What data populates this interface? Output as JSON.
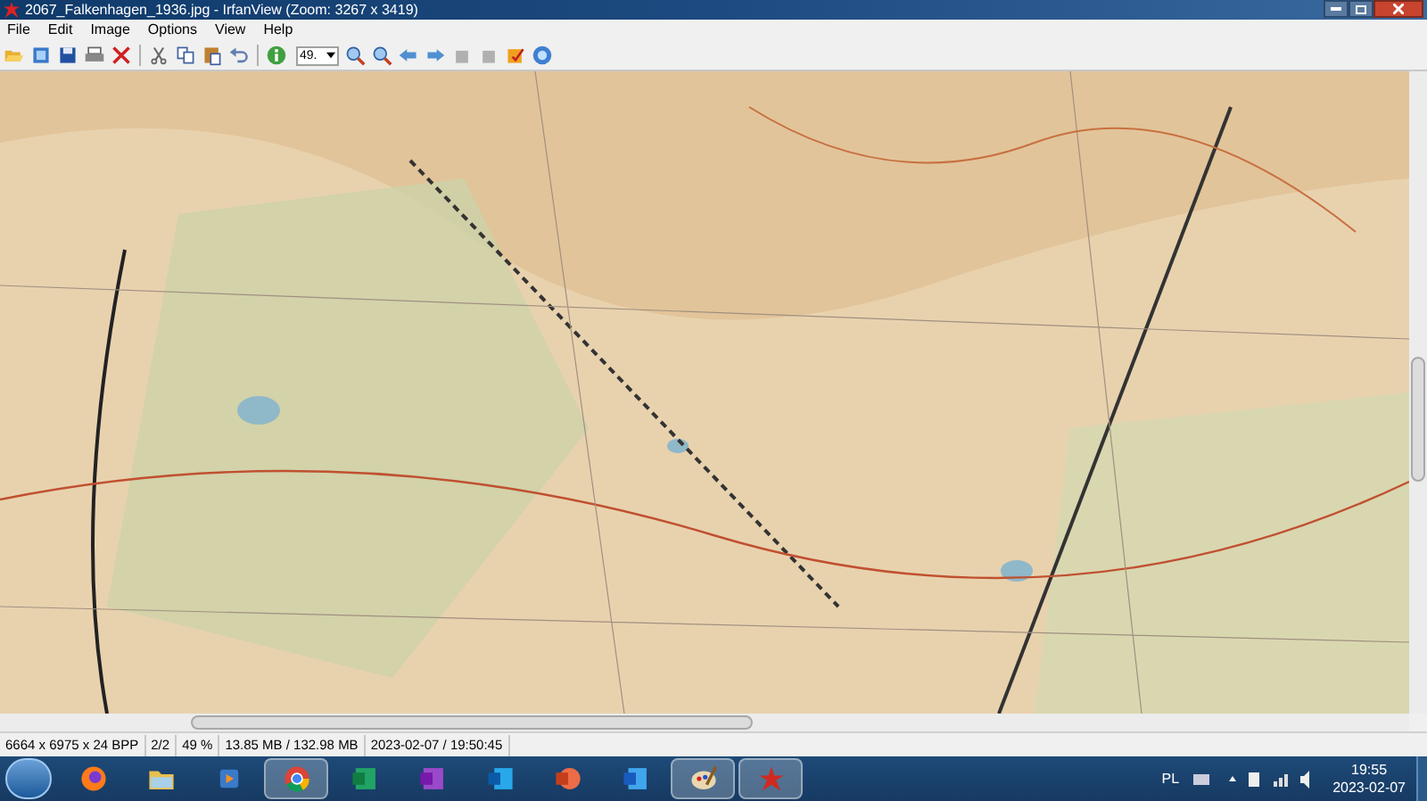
{
  "window": {
    "title": "2067_Falkenhagen_1936.jpg - IrfanView (Zoom: 3267 x 3419)"
  },
  "menu": [
    "File",
    "Edit",
    "Image",
    "Options",
    "View",
    "Help"
  ],
  "toolbar": {
    "left": [
      {
        "kind": "open"
      },
      {
        "kind": "thumbs"
      },
      {
        "kind": "save"
      },
      {
        "kind": "print"
      },
      {
        "kind": "delete"
      }
    ],
    "middle": [
      {
        "kind": "cut"
      },
      {
        "kind": "copy"
      },
      {
        "kind": "paste"
      },
      {
        "kind": "undo"
      }
    ],
    "info": [
      {
        "kind": "info"
      }
    ],
    "zoom_value": "49.",
    "right": [
      {
        "kind": "zoom-in"
      },
      {
        "kind": "zoom-out"
      },
      {
        "kind": "prev"
      },
      {
        "kind": "next"
      },
      {
        "kind": "rotate-left"
      },
      {
        "kind": "rotate-right"
      },
      {
        "kind": "edit"
      },
      {
        "kind": "help"
      }
    ]
  },
  "image": {
    "kind": "picture"
  },
  "status_bar": [
    "6664 x 6975 x 24 BPP",
    "2/2",
    "49 %",
    "13.85 MB / 132.98 MB",
    "2023-02-07 / 19:50:45"
  ],
  "taskbar": {
    "apps": [
      {
        "kind": "firefox",
        "selected": false
      },
      {
        "kind": "folder",
        "selected": false
      },
      {
        "kind": "player",
        "selected": false
      },
      {
        "kind": "chrome",
        "selected": true
      },
      {
        "kind": "excel",
        "selected": false
      },
      {
        "kind": "onenote",
        "selected": false
      },
      {
        "kind": "outlook",
        "selected": false
      },
      {
        "kind": "powerpoint",
        "selected": false
      },
      {
        "kind": "word",
        "selected": false
      },
      {
        "kind": "paint",
        "selected": true
      },
      {
        "kind": "irfan",
        "selected": true
      }
    ],
    "language": "PL",
    "time": "19:55",
    "date": "2023-02-07"
  }
}
